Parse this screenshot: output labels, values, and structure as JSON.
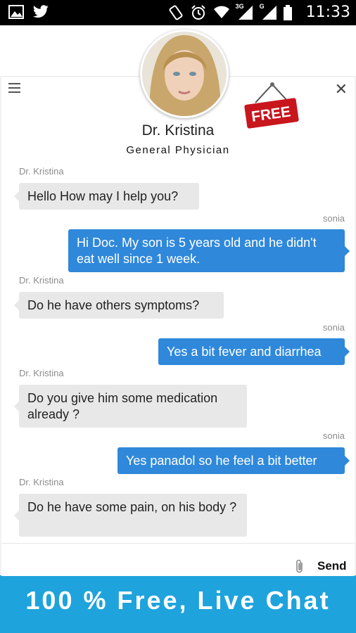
{
  "status_bar": {
    "time": "11:33",
    "net_3g": "3G",
    "net_g": "G",
    "icons": [
      "image-icon",
      "twitter-icon",
      "rotate-icon",
      "alarm-icon",
      "wifi-icon",
      "signal-icon",
      "signal-icon",
      "battery-icon"
    ]
  },
  "doctor": {
    "name": "Dr. Kristina",
    "specialty": "General Physician",
    "badge": "FREE"
  },
  "messages": [
    {
      "sender": "Dr. Kristina",
      "text": "Hello  How may I help you?",
      "direction": "in"
    },
    {
      "sender": "sonia",
      "text": "Hi Doc. My son is 5 years old and he didn't eat well since 1 week.",
      "direction": "out"
    },
    {
      "sender": "Dr. Kristina",
      "text": "Do he have others symptoms?",
      "direction": "in"
    },
    {
      "sender": "sonia",
      "text": "Yes a bit fever and diarrhea",
      "direction": "out"
    },
    {
      "sender": "Dr. Kristina",
      "text": "Do you give him some medication already ?",
      "direction": "in"
    },
    {
      "sender": "sonia",
      "text": "Yes panadol so he feel a bit better",
      "direction": "out"
    },
    {
      "sender": "Dr. Kristina",
      "text": "Do he have some pain, on his body ?",
      "direction": "in"
    }
  ],
  "composer": {
    "send_label": "Send"
  },
  "banner": {
    "text": "100 % Free, Live Chat"
  },
  "colors": {
    "outgoing_bubble": "#2f88da",
    "incoming_bubble": "#e8e8e8",
    "banner": "#1fa3dc"
  }
}
